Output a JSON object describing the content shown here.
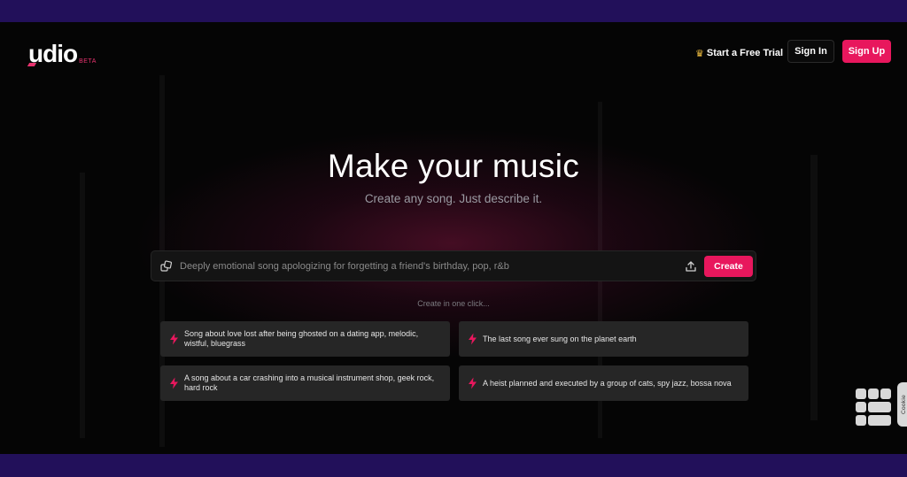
{
  "header": {
    "logo_text": "udio",
    "logo_badge": "BETA",
    "trial_label": "Start a Free Trial",
    "signin_label": "Sign In",
    "signup_label": "Sign Up"
  },
  "hero": {
    "title": "Make your music",
    "subtitle": "Create any song. Just describe it."
  },
  "prompt": {
    "placeholder": "Deeply emotional song apologizing for forgetting a friend's birthday, pop, r&b",
    "value": "",
    "create_label": "Create"
  },
  "suggestions": {
    "heading": "Create in one click...",
    "items": [
      {
        "text": "Song about love lost after being ghosted on a dating app, melodic, wistful, bluegrass"
      },
      {
        "text": "The last song ever sung on the planet earth"
      },
      {
        "text": "A song about a car crashing into a musical instrument shop, geek rock, hard rock"
      },
      {
        "text": "A heist planned and executed by a group of cats, spy jazz, bossa nova"
      }
    ]
  },
  "cookie_tab": {
    "label": "Cookie"
  },
  "colors": {
    "accent": "#e8175d",
    "frame": "#22105a",
    "background": "#050505",
    "card": "#262626"
  },
  "icons": {
    "dice": "dice-icon",
    "upload": "upload-icon",
    "bolt": "bolt-icon",
    "crown": "crown-icon"
  }
}
